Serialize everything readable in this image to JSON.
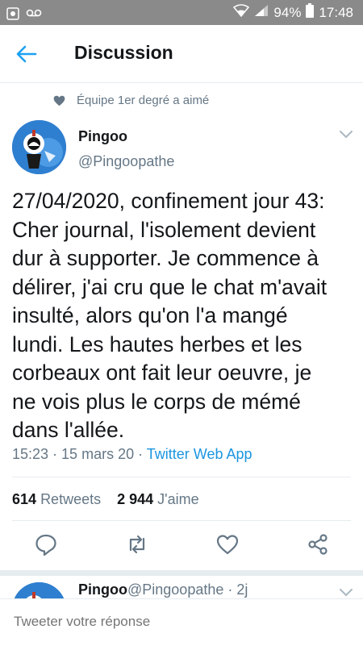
{
  "status_bar": {
    "battery": "94%",
    "time": "17:48"
  },
  "header": {
    "title": "Discussion"
  },
  "social_context": {
    "text": "Équipe 1er degré a aimé"
  },
  "tweet": {
    "author_name": "Pingoo",
    "author_handle": "@Pingoopathe",
    "text": "27/04/2020, confinement jour 43:\nCher journal, l'isolement devient\ndur à supporter. Je commence à\ndélirer, j'ai cru que le chat m'avait\ninsulté, alors qu'on l'a mangé\nlundi. Les hautes herbes et les\ncorbeaux ont fait leur oeuvre, je\nne vois plus le corps de mémé\ndans l'allée.",
    "time": "15:23",
    "date": "15 mars 20",
    "separator": " · ",
    "source": "Twitter Web App",
    "retweets_count": "614",
    "retweets_label": "Retweets",
    "likes_count": "2 944",
    "likes_label": "J'aime"
  },
  "reply_preview": {
    "author_name": "Pingoo",
    "author_handle": "@Pingoopathe · 2j"
  },
  "composer": {
    "placeholder": "Tweeter votre réponse"
  },
  "colors": {
    "accent": "#1b95e0",
    "secondary_text": "#657786",
    "status_bar": "#8a8a8a"
  }
}
